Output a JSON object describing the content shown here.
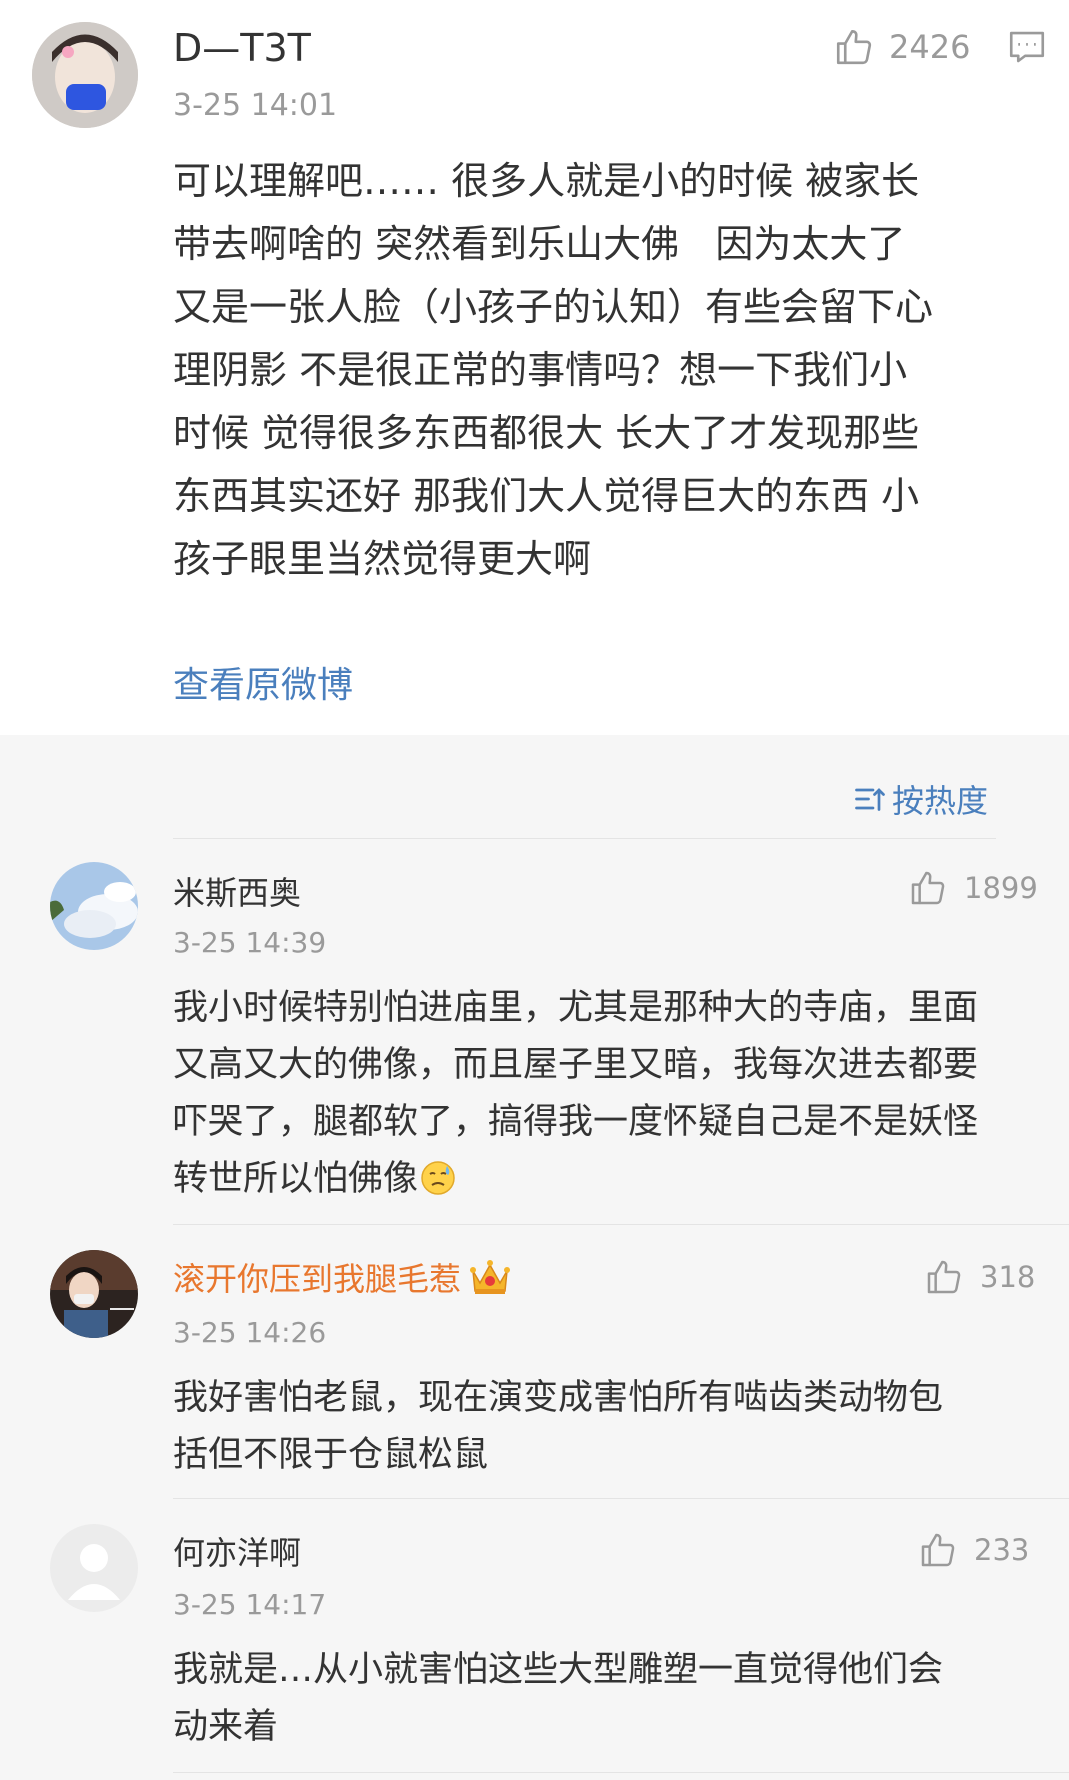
{
  "post": {
    "author": "D—T3T",
    "time": "3-25 14:01",
    "likes": "2426",
    "text": "可以理解吧…… 很多人就是小的时候 被家长\n带去啊啥的 突然看到乐山大佛   因为太大了\n又是一张人脸（小孩子的认知）有些会留下心\n理阴影 不是很正常的事情吗？想一下我们小\n时候 觉得很多东西都很大 长大了才发现那些\n东西其实还好 那我们大人觉得巨大的东西 小\n孩子眼里当然觉得更大啊",
    "view_original": "查看原微博"
  },
  "sort": {
    "label": "按热度"
  },
  "comments": [
    {
      "author": "米斯西奥",
      "time": "3-25 14:39",
      "likes": "1899",
      "text": "我小时候特别怕进庙里，尤其是那种大的寺庙，里面\n又高又大的佛像，而且屋子里又暗，我每次进去都要\n吓哭了，腿都软了，搞得我一度怀疑自己是不是妖怪\n转世所以怕佛像"
    },
    {
      "author": "滚开你压到我腿毛惹",
      "time": "3-25 14:26",
      "likes": "318",
      "text": "我好害怕老鼠，现在演变成害怕所有啮齿类动物包\n括但不限于仓鼠松鼠"
    },
    {
      "author": "何亦洋啊",
      "time": "3-25 14:17",
      "likes": "233",
      "text": "我就是…从小就害怕这些大型雕塑一直觉得他们会\n动来着"
    }
  ],
  "colors": {
    "link": "#4a7fbd",
    "orange_name": "#e8772e",
    "gray": "#9a9a9a",
    "text": "#333333"
  }
}
